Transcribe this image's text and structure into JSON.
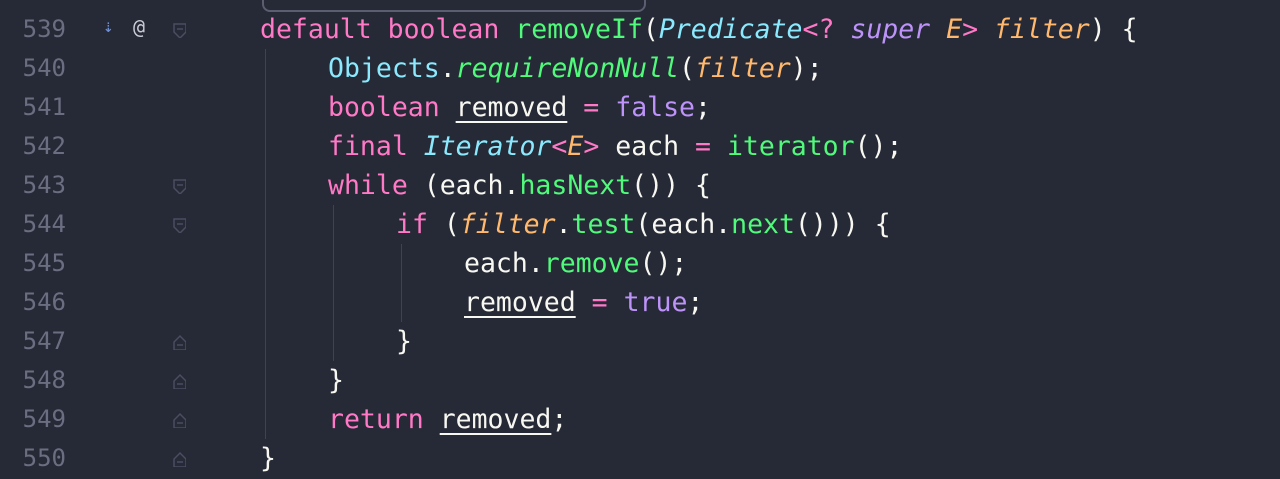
{
  "editor": {
    "lines": [
      {
        "number": "539",
        "indent": 0,
        "tokens": [
          {
            "t": "default ",
            "c": "kw"
          },
          {
            "t": "boolean ",
            "c": "kw"
          },
          {
            "t": "removeIf",
            "c": "fn"
          },
          {
            "t": "(",
            "c": "pl"
          },
          {
            "t": "Predicate",
            "c": "tyi"
          },
          {
            "t": "<? ",
            "c": "kw"
          },
          {
            "t": "super ",
            "c": "cst",
            "i": true
          },
          {
            "t": "E",
            "c": "par"
          },
          {
            "t": "> ",
            "c": "kw"
          },
          {
            "t": "filter",
            "c": "par"
          },
          {
            "t": ") {",
            "c": "pl"
          }
        ]
      },
      {
        "number": "540",
        "indent": 1,
        "tokens": [
          {
            "t": "Objects",
            "c": "ty"
          },
          {
            "t": ".",
            "c": "pl"
          },
          {
            "t": "requireNonNull",
            "c": "fni"
          },
          {
            "t": "(",
            "c": "pl"
          },
          {
            "t": "filter",
            "c": "par"
          },
          {
            "t": ");",
            "c": "pl"
          }
        ]
      },
      {
        "number": "541",
        "indent": 1,
        "tokens": [
          {
            "t": "boolean ",
            "c": "kw"
          },
          {
            "t": "removed",
            "c": "pl",
            "u": true
          },
          {
            "t": " ",
            "c": "pl"
          },
          {
            "t": "=",
            "c": "kw"
          },
          {
            "t": " ",
            "c": "pl"
          },
          {
            "t": "false",
            "c": "cst"
          },
          {
            "t": ";",
            "c": "pl"
          }
        ]
      },
      {
        "number": "542",
        "indent": 1,
        "tokens": [
          {
            "t": "final ",
            "c": "kw"
          },
          {
            "t": "Iterator",
            "c": "tyi"
          },
          {
            "t": "<",
            "c": "kw"
          },
          {
            "t": "E",
            "c": "par"
          },
          {
            "t": ">",
            "c": "kw"
          },
          {
            "t": " each ",
            "c": "pl"
          },
          {
            "t": "=",
            "c": "kw"
          },
          {
            "t": " ",
            "c": "pl"
          },
          {
            "t": "iterator",
            "c": "fn"
          },
          {
            "t": "();",
            "c": "pl"
          }
        ]
      },
      {
        "number": "543",
        "indent": 1,
        "tokens": [
          {
            "t": "while ",
            "c": "kw"
          },
          {
            "t": "(each.",
            "c": "pl"
          },
          {
            "t": "hasNext",
            "c": "fn"
          },
          {
            "t": "()) {",
            "c": "pl"
          }
        ]
      },
      {
        "number": "544",
        "indent": 2,
        "tokens": [
          {
            "t": "if ",
            "c": "kw"
          },
          {
            "t": "(",
            "c": "pl"
          },
          {
            "t": "filter",
            "c": "par"
          },
          {
            "t": ".",
            "c": "pl"
          },
          {
            "t": "test",
            "c": "fn"
          },
          {
            "t": "(each.",
            "c": "pl"
          },
          {
            "t": "next",
            "c": "fn"
          },
          {
            "t": "())) {",
            "c": "pl"
          }
        ]
      },
      {
        "number": "545",
        "indent": 3,
        "tokens": [
          {
            "t": "each.",
            "c": "pl"
          },
          {
            "t": "remove",
            "c": "fn"
          },
          {
            "t": "();",
            "c": "pl"
          }
        ]
      },
      {
        "number": "546",
        "indent": 3,
        "tokens": [
          {
            "t": "removed",
            "c": "pl",
            "u": true
          },
          {
            "t": " ",
            "c": "pl"
          },
          {
            "t": "=",
            "c": "kw"
          },
          {
            "t": " ",
            "c": "pl"
          },
          {
            "t": "true",
            "c": "cst"
          },
          {
            "t": ";",
            "c": "pl"
          }
        ]
      },
      {
        "number": "547",
        "indent": 2,
        "tokens": [
          {
            "t": "}",
            "c": "pl"
          }
        ]
      },
      {
        "number": "548",
        "indent": 1,
        "tokens": [
          {
            "t": "}",
            "c": "pl"
          }
        ]
      },
      {
        "number": "549",
        "indent": 1,
        "tokens": [
          {
            "t": "return ",
            "c": "kw"
          },
          {
            "t": "removed",
            "c": "pl",
            "u": true
          },
          {
            "t": ";",
            "c": "pl"
          }
        ]
      },
      {
        "number": "550",
        "indent": 0,
        "tokens": [
          {
            "t": "}",
            "c": "pl"
          }
        ]
      }
    ],
    "folds": [
      {
        "line": "539",
        "type": "open"
      },
      {
        "line": "543",
        "type": "open"
      },
      {
        "line": "544",
        "type": "open"
      },
      {
        "line": "547",
        "type": "close"
      },
      {
        "line": "548",
        "type": "close"
      },
      {
        "line": "549",
        "type": "close"
      },
      {
        "line": "550",
        "type": "close"
      }
    ],
    "gutter_icons": [
      {
        "line": "539",
        "icon": "implementations-icon",
        "symbol": "⇣"
      },
      {
        "line": "539",
        "icon": "override-annotation-icon",
        "symbol": "@"
      }
    ],
    "colors": {
      "background": "#262936",
      "line_number": "#6a6e80",
      "keyword": "#ff79c6",
      "function": "#50fa7b",
      "type": "#8be9fd",
      "parameter": "#ffb86c",
      "constant": "#bd93f9",
      "plain": "#f8f8f2"
    }
  }
}
